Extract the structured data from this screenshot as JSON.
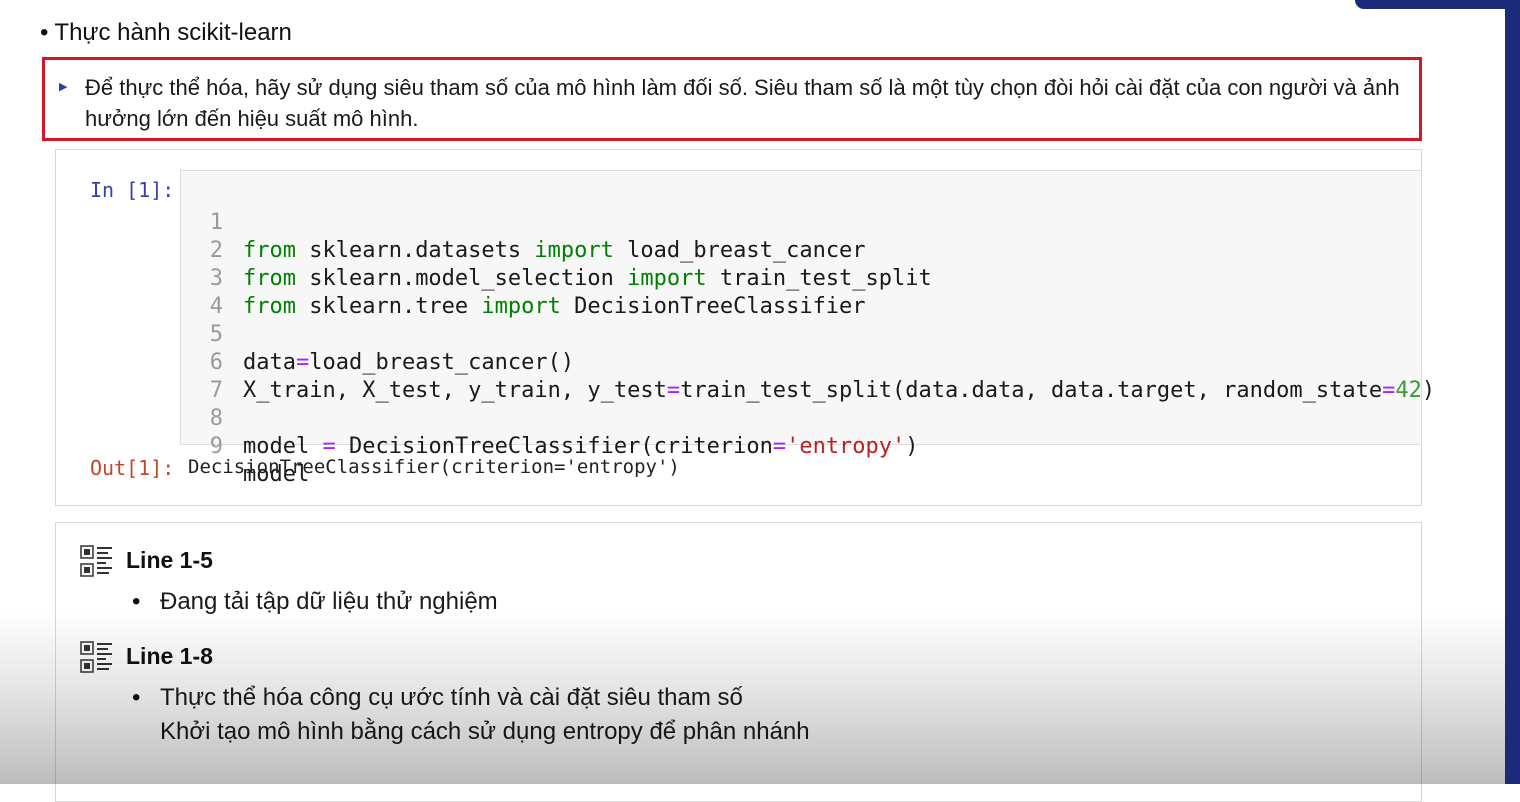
{
  "heading": "Thực hành scikit-learn",
  "callout": "Để thực thể hóa, hãy sử dụng siêu tham số của mô hình làm đối số. Siêu tham số là một tùy chọn đòi hỏi cài đặt của con người và ảnh hưởng lớn đến hiệu suất mô hình.",
  "cell": {
    "in_prompt": "In [1]:",
    "out_prompt": "Out[1]:",
    "line_numbers": [
      "1",
      "2",
      "3",
      "4",
      "5",
      "6",
      "7",
      "8",
      "9"
    ],
    "output": "DecisionTreeClassifier(criterion='entropy')"
  },
  "notes": [
    {
      "title": "Line 1-5",
      "lines": [
        "Đang tải tập dữ liệu thử nghiệm"
      ]
    },
    {
      "title": "Line 1-8",
      "lines": [
        "Thực thể hóa công cụ ước tính và cài đặt siêu tham số",
        "Khởi tạo mô hình bằng cách sử dụng entropy để phân nhánh"
      ]
    }
  ],
  "icons": {
    "note_icon": "code-document-icon"
  },
  "colors": {
    "callout_border": "#d7141f",
    "accent": "#1b2a7a",
    "keyword": "#008000",
    "string": "#ba2121",
    "number": "#3a9a3a"
  }
}
